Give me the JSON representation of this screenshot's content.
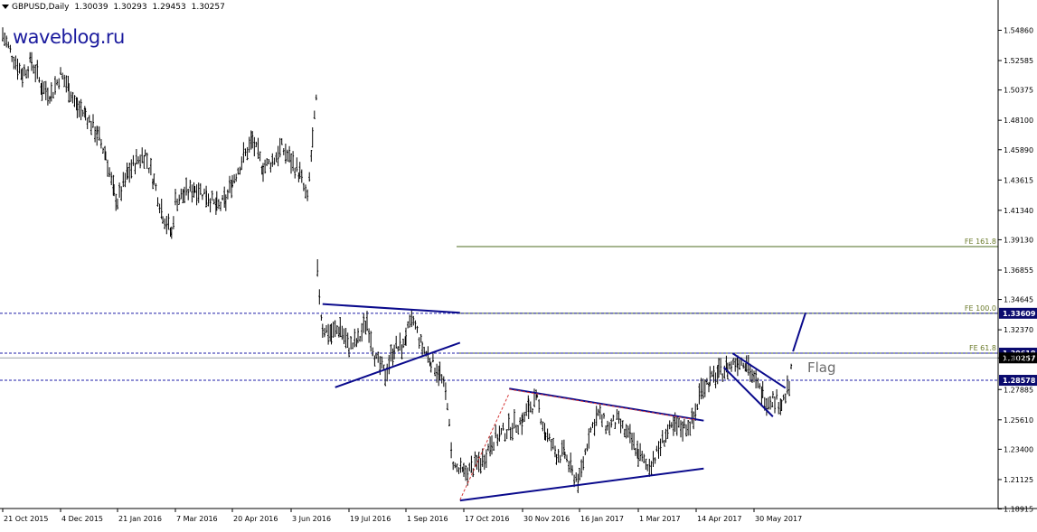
{
  "header": {
    "symbol": "GBPUSD,Daily",
    "open": "1.30039",
    "high": "1.30293",
    "low": "1.29453",
    "close": "1.30257"
  },
  "watermark": "waveblog.ru",
  "annotations": {
    "flag_label": "Flag",
    "fe_161": "FE 161.8",
    "fe_100": "FE 100.0",
    "fe_61": "FE 61.8"
  },
  "colors": {
    "background": "#ffffff",
    "bars": "#000000",
    "trendline": "#0a0a8c",
    "dashed_level": "#1f1fa8",
    "fe_line": "#4d6b1f",
    "fe_text": "#6b7a2a",
    "price_box": "#0a0a6e",
    "red_dashed": "#d63a3a"
  },
  "chart_data": {
    "type": "ohlc",
    "title": "GBPUSD,Daily",
    "ylim": [
      1.1895,
      1.5625
    ],
    "y_ticks": [
      "1.54860",
      "1.52585",
      "1.50375",
      "1.48100",
      "1.45890",
      "1.43615",
      "1.41340",
      "1.39130",
      "1.36855",
      "1.34645",
      "1.32370",
      "1.30257",
      "1.27885",
      "1.25610",
      "1.23400",
      "1.21125",
      "1.18915"
    ],
    "x_ticks": [
      "21 Oct 2015",
      "4 Dec 2015",
      "21 Jan 2016",
      "7 Mar 2016",
      "20 Apr 2016",
      "3 Jun 2016",
      "19 Jul 2016",
      "1 Sep 2016",
      "17 Oct 2016",
      "30 Nov 2016",
      "16 Jan 2017",
      "1 Mar 2017",
      "14 Apr 2017",
      "30 May 2017"
    ],
    "price_labels": [
      {
        "label": "1.33609",
        "value": 1.33609,
        "style": "dashed"
      },
      {
        "label": "1.30618",
        "value": 1.30618,
        "style": "dashed"
      },
      {
        "label": "1.30257",
        "value": 1.30257,
        "style": "solid"
      },
      {
        "label": "1.28578",
        "value": 1.28578,
        "style": "dashed"
      }
    ],
    "fe_levels": [
      {
        "name": "FE 161.8",
        "value": 1.3862
      },
      {
        "name": "FE 100.0",
        "value": 1.33609
      },
      {
        "name": "FE 61.8",
        "value": 1.30618
      }
    ],
    "price_path": [
      [
        "2015-10-21",
        1.545
      ],
      [
        "2015-10-28",
        1.53
      ],
      [
        "2015-11-05",
        1.515
      ],
      [
        "2015-11-12",
        1.525
      ],
      [
        "2015-11-20",
        1.505
      ],
      [
        "2015-11-27",
        1.5
      ],
      [
        "2015-12-04",
        1.515
      ],
      [
        "2015-12-11",
        1.505
      ],
      [
        "2015-12-18",
        1.49
      ],
      [
        "2015-12-25",
        1.485
      ],
      [
        "2016-01-04",
        1.47
      ],
      [
        "2016-01-11",
        1.455
      ],
      [
        "2016-01-18",
        1.425
      ],
      [
        "2016-01-21",
        1.42
      ],
      [
        "2016-01-29",
        1.44
      ],
      [
        "2016-02-05",
        1.45
      ],
      [
        "2016-02-12",
        1.455
      ],
      [
        "2016-02-19",
        1.435
      ],
      [
        "2016-02-26",
        1.41
      ],
      [
        "2016-03-04",
        1.395
      ],
      [
        "2016-03-07",
        1.42
      ],
      [
        "2016-03-14",
        1.425
      ],
      [
        "2016-03-22",
        1.43
      ],
      [
        "2016-03-31",
        1.425
      ],
      [
        "2016-04-08",
        1.415
      ],
      [
        "2016-04-15",
        1.42
      ],
      [
        "2016-04-20",
        1.435
      ],
      [
        "2016-04-27",
        1.45
      ],
      [
        "2016-05-05",
        1.465
      ],
      [
        "2016-05-13",
        1.445
      ],
      [
        "2016-05-20",
        1.45
      ],
      [
        "2016-05-27",
        1.46
      ],
      [
        "2016-06-03",
        1.45
      ],
      [
        "2016-06-10",
        1.44
      ],
      [
        "2016-06-16",
        1.42
      ],
      [
        "2016-06-20",
        1.465
      ],
      [
        "2016-06-23",
        1.495
      ],
      [
        "2016-06-24",
        1.365
      ],
      [
        "2016-06-28",
        1.325
      ],
      [
        "2016-07-05",
        1.32
      ],
      [
        "2016-07-12",
        1.325
      ],
      [
        "2016-07-19",
        1.31
      ],
      [
        "2016-07-26",
        1.315
      ],
      [
        "2016-08-02",
        1.33
      ],
      [
        "2016-08-09",
        1.3
      ],
      [
        "2016-08-16",
        1.29
      ],
      [
        "2016-08-23",
        1.31
      ],
      [
        "2016-08-30",
        1.31
      ],
      [
        "2016-09-01",
        1.32
      ],
      [
        "2016-09-07",
        1.33
      ],
      [
        "2016-09-14",
        1.31
      ],
      [
        "2016-09-21",
        1.3
      ],
      [
        "2016-09-28",
        1.29
      ],
      [
        "2016-10-04",
        1.27
      ],
      [
        "2016-10-07",
        1.23
      ],
      [
        "2016-10-10",
        1.22
      ],
      [
        "2016-10-17",
        1.215
      ],
      [
        "2016-10-24",
        1.22
      ],
      [
        "2016-10-31",
        1.225
      ],
      [
        "2016-11-07",
        1.24
      ],
      [
        "2016-11-14",
        1.245
      ],
      [
        "2016-11-21",
        1.25
      ],
      [
        "2016-11-30",
        1.255
      ],
      [
        "2016-12-05",
        1.265
      ],
      [
        "2016-12-12",
        1.27
      ],
      [
        "2016-12-19",
        1.245
      ],
      [
        "2016-12-28",
        1.23
      ],
      [
        "2017-01-04",
        1.23
      ],
      [
        "2017-01-10",
        1.215
      ],
      [
        "2017-01-16",
        1.21
      ],
      [
        "2017-01-23",
        1.245
      ],
      [
        "2017-01-30",
        1.26
      ],
      [
        "2017-02-06",
        1.25
      ],
      [
        "2017-02-13",
        1.255
      ],
      [
        "2017-02-20",
        1.245
      ],
      [
        "2017-02-27",
        1.235
      ],
      [
        "2017-03-01",
        1.23
      ],
      [
        "2017-03-08",
        1.22
      ],
      [
        "2017-03-15",
        1.23
      ],
      [
        "2017-03-22",
        1.245
      ],
      [
        "2017-03-29",
        1.25
      ],
      [
        "2017-04-05",
        1.25
      ],
      [
        "2017-04-12",
        1.255
      ],
      [
        "2017-04-18",
        1.28
      ],
      [
        "2017-04-25",
        1.285
      ],
      [
        "2017-05-02",
        1.29
      ],
      [
        "2017-05-09",
        1.295
      ],
      [
        "2017-05-17",
        1.3
      ],
      [
        "2017-05-24",
        1.3
      ],
      [
        "2017-05-30",
        1.285
      ],
      [
        "2017-06-06",
        1.275
      ],
      [
        "2017-06-09",
        1.27
      ],
      [
        "2017-06-14",
        1.272
      ],
      [
        "2017-06-21",
        1.268
      ],
      [
        "2017-06-27",
        1.28
      ],
      [
        "2017-06-30",
        1.302
      ]
    ],
    "trendlines": [
      {
        "name": "triangle-upper",
        "from": [
          "2016-06-28",
          1.343
        ],
        "to": [
          "2016-10-14",
          1.3365
        ],
        "color": "#0a0a8c"
      },
      {
        "name": "triangle-lower",
        "from": [
          "2016-07-08",
          1.2805
        ],
        "to": [
          "2016-10-14",
          1.314
        ],
        "color": "#0a0a8c"
      },
      {
        "name": "wedge-upper",
        "from": [
          "2016-11-20",
          1.2795
        ],
        "to": [
          "2017-04-20",
          1.2555
        ],
        "color": "#0a0a8c"
      },
      {
        "name": "wedge-lower",
        "from": [
          "2016-10-14",
          1.1955
        ],
        "to": [
          "2017-04-20",
          1.2195
        ],
        "color": "#0a0a8c"
      },
      {
        "name": "flag-upper",
        "from": [
          "2017-05-13",
          1.306
        ],
        "to": [
          "2017-06-24",
          1.28
        ],
        "color": "#0a0a8c"
      },
      {
        "name": "flag-lower",
        "from": [
          "2017-05-06",
          1.2955
        ],
        "to": [
          "2017-06-14",
          1.2585
        ],
        "color": "#0a0a8c"
      },
      {
        "name": "projection",
        "from": [
          "2017-06-30",
          1.3075
        ],
        "to": [
          "2017-07-10",
          1.3365
        ],
        "color": "#0a0a8c"
      },
      {
        "name": "red-dashed",
        "from": [
          "2016-10-14",
          1.196
        ],
        "to": [
          "2016-11-20",
          1.276
        ],
        "color": "#d63a3a"
      },
      {
        "name": "red-dashed-wedge",
        "from": [
          "2016-11-20",
          1.279
        ],
        "to": [
          "2017-04-14",
          1.256
        ],
        "color": "#d63a3a"
      }
    ],
    "grid": false
  }
}
